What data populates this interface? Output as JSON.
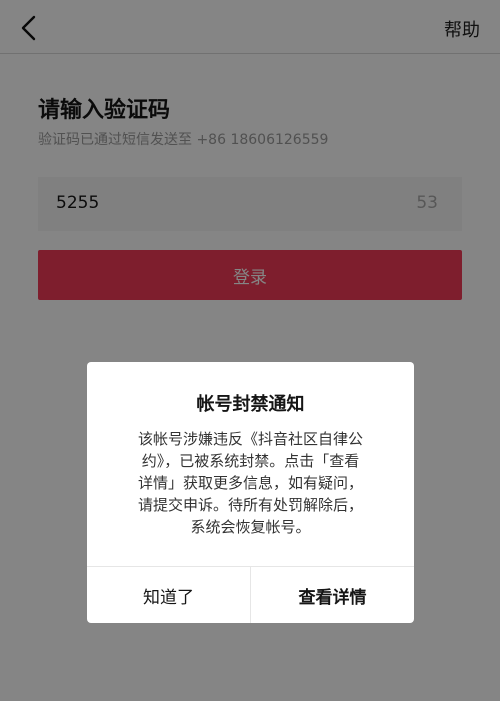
{
  "nav": {
    "back_icon": "chevron-left-icon",
    "help_label": "帮助"
  },
  "login": {
    "title": "请输入验证码",
    "sms_hint": "验证码已通过短信发送至 +86 18606126559",
    "code_value": "5255",
    "countdown": "53",
    "login_label": "登录"
  },
  "dialog": {
    "title": "帐号封禁通知",
    "body_lines": [
      "该帐号涉嫌违反《抖音社区自律公",
      "约》，已被系统封禁。点击「查看",
      "详情」获取更多信息，如有疑问，",
      "请提交申诉。待所有处罚解除后，",
      "系统会恢复帐号。"
    ],
    "cancel_label": "知道了",
    "details_label": "查看详情"
  },
  "colors": {
    "accent": "#f23a56",
    "overlay": "rgba(0,0,0,0.48)"
  }
}
